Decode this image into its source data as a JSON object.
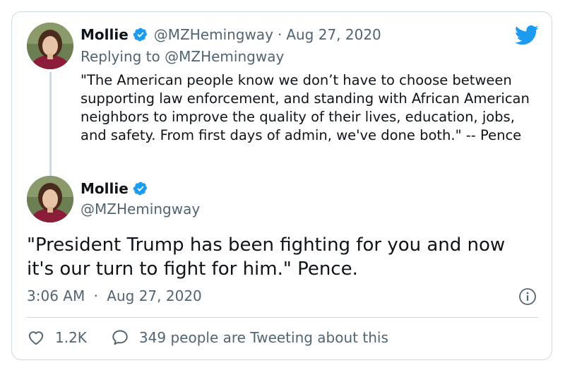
{
  "parent_tweet": {
    "author_name": "Mollie",
    "handle": "@MZHemingway",
    "separator": "·",
    "date": "Aug 27, 2020",
    "reply_label": "Replying to ",
    "reply_mention": "@MZHemingway",
    "text": "\"The American people know we don’t have to choose between supporting law enforcement, and standing with African American neighbors to improve the quality of their lives, education, jobs, and safety. From first days of admin, we've done both.\" -- Pence"
  },
  "main_tweet": {
    "author_name": "Mollie",
    "handle": "@MZHemingway",
    "text": "\"President Trump has been fighting for you and now it's our turn to fight for him.\" Pence.",
    "time": "3:06 AM",
    "separator": "·",
    "date": "Aug 27, 2020"
  },
  "actions": {
    "like_count": "1.2K",
    "conversation_text": "349 people are Tweeting about this"
  },
  "colors": {
    "brand_blue": "#1d9bf0",
    "text_primary": "#0f1419",
    "text_secondary": "#536471",
    "border": "#cfd9de"
  },
  "icons": {
    "logo": "twitter-bird-icon",
    "verified": "verified-badge-icon",
    "info": "info-icon",
    "like": "heart-icon",
    "conversation": "speech-bubble-icon"
  }
}
